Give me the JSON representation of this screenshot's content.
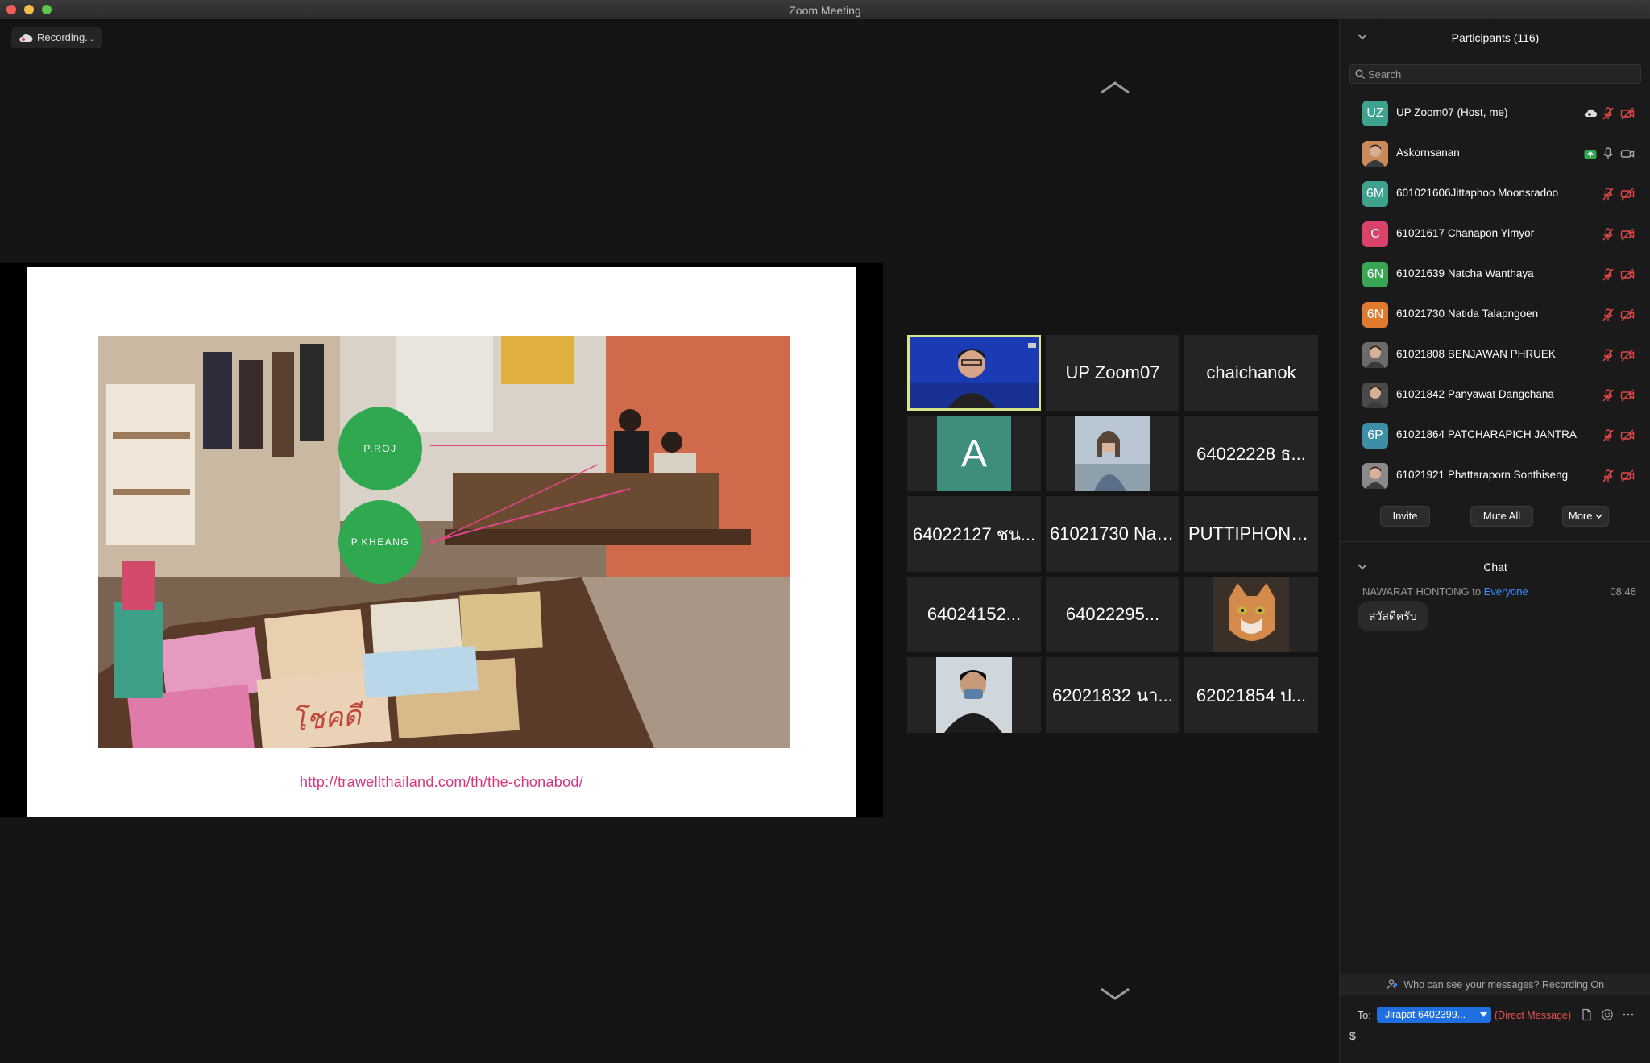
{
  "window": {
    "title": "Zoom Meeting"
  },
  "recording": {
    "label": "Recording..."
  },
  "slide": {
    "bubble1": "P.ROJ",
    "bubble2": "P.KHEANG",
    "url": "http://trawellthailand.com/th/the-chonabod/"
  },
  "gallery": {
    "tiles": [
      {
        "name": "",
        "kind": "video-active"
      },
      {
        "name": "UP Zoom07",
        "kind": "name"
      },
      {
        "name": "chaichanok",
        "kind": "name"
      },
      {
        "name": "A",
        "kind": "avatar-letter"
      },
      {
        "name": "",
        "kind": "photo-woman"
      },
      {
        "name": "64022228 ธ...",
        "kind": "name"
      },
      {
        "name": "64022127 ชน...",
        "kind": "name"
      },
      {
        "name": "61021730 Nat...",
        "kind": "name"
      },
      {
        "name": "PUTTIPHONG...",
        "kind": "name"
      },
      {
        "name": "64024152...",
        "kind": "name"
      },
      {
        "name": "64022295...",
        "kind": "name"
      },
      {
        "name": "",
        "kind": "photo-cat"
      },
      {
        "name": "",
        "kind": "photo-man"
      },
      {
        "name": "62021832 นา...",
        "kind": "name"
      },
      {
        "name": "62021854 ป...",
        "kind": "name"
      }
    ]
  },
  "participants": {
    "title": "Participants (116)",
    "search_placeholder": "Search",
    "list": [
      {
        "initials": "UZ",
        "color": "#3fa28f",
        "name": "UP Zoom07 (Host, me)"
      },
      {
        "initials": "",
        "color": "#c98a5c",
        "name": "Askornsanan"
      },
      {
        "initials": "6M",
        "color": "#3fa28f",
        "name": "601021606Jittaphoo Moonsradoo"
      },
      {
        "initials": "C",
        "color": "#d9426a",
        "name": "61021617 Chanapon Yimyor"
      },
      {
        "initials": "6N",
        "color": "#3aa655",
        "name": "61021639 Natcha Wanthaya"
      },
      {
        "initials": "6N",
        "color": "#e07a2e",
        "name": "61021730 Natida Talapngoen"
      },
      {
        "initials": "",
        "color": "#6b6b6b",
        "name": "61021808 BENJAWAN PHRUEK"
      },
      {
        "initials": "",
        "color": "#4a4a4a",
        "name": "61021842 Panyawat Dangchana"
      },
      {
        "initials": "6P",
        "color": "#3d8fa8",
        "name": "61021864 PATCHARAPICH JANTRA"
      },
      {
        "initials": "",
        "color": "#8a8a8a",
        "name": "61021921 Phattaraporn Sonthiseng"
      }
    ],
    "invite_label": "Invite",
    "mute_all_label": "Mute All",
    "more_label": "More"
  },
  "chat": {
    "title": "Chat",
    "messages": [
      {
        "from": "NAWARAT HONTONG",
        "connector": "to",
        "to": "Everyone",
        "time": "08:48",
        "text": "สวัสดีครับ"
      }
    ],
    "privacy_notice": "Who can see your messages? Recording On",
    "to_label": "To:",
    "recipient": "Jirapat 6402399...",
    "dm_label": "(Direct Message)",
    "input_value": "$"
  },
  "colors": {
    "accent_blue": "#1f6fe0",
    "active_speaker": "#d9e58b",
    "mic_off_red": "#e04848",
    "slide_link": "#d6367c",
    "bubble_green": "#2fa84f"
  }
}
